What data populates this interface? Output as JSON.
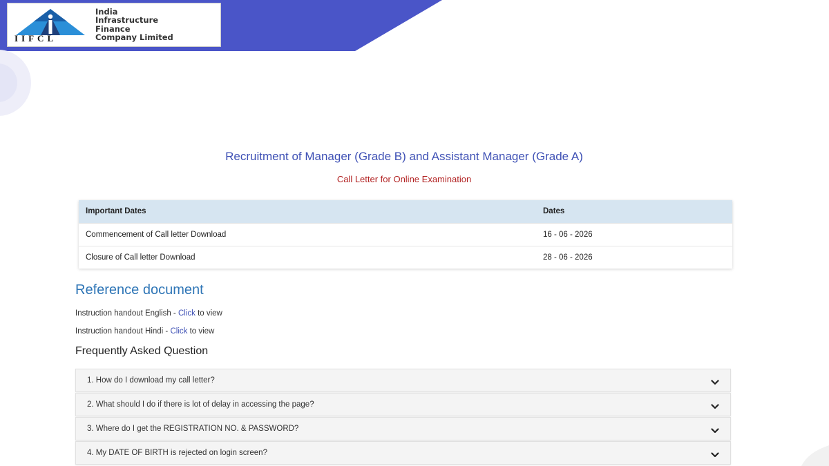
{
  "logo": {
    "abbr": "IIFCL",
    "name_lines": [
      "India",
      "Infrastructure",
      "Finance",
      "Company Limited"
    ]
  },
  "page": {
    "title": "Recruitment of Manager (Grade B) and Assistant Manager (Grade A)",
    "subtitle": "Call Letter for Online Examination"
  },
  "dates_table": {
    "headers": [
      "Important Dates",
      "Dates"
    ],
    "rows": [
      {
        "event": "Commencement of Call letter Download",
        "date": "16 - 06 - 2026"
      },
      {
        "event": "Closure of Call letter Download",
        "date": "28 - 06 - 2026"
      }
    ]
  },
  "reference": {
    "heading": "Reference document",
    "items": [
      {
        "prefix": "Instruction handout English - ",
        "link": "Click",
        "suffix": " to view"
      },
      {
        "prefix": "Instruction handout Hindi - ",
        "link": "Click",
        "suffix": " to view"
      }
    ]
  },
  "faq": {
    "heading": "Frequently Asked Question",
    "items": [
      "1. How do I download my call letter?",
      "2. What should I do if there is lot of delay in accessing the page?",
      "3. Where do I get the REGISTRATION NO. & PASSWORD?",
      "4. My DATE OF BIRTH is rejected on login screen?"
    ]
  },
  "colors": {
    "header_band": "#4a55c8",
    "title": "#3f51b5",
    "subtitle": "#b22222",
    "table_header": "#d6e5f1",
    "reference_heading": "#2e75b6",
    "link": "#3f51b5"
  },
  "icons": {
    "faq_toggle": "chevron-down-icon",
    "logo_mark": "iifcl-logo-icon"
  }
}
